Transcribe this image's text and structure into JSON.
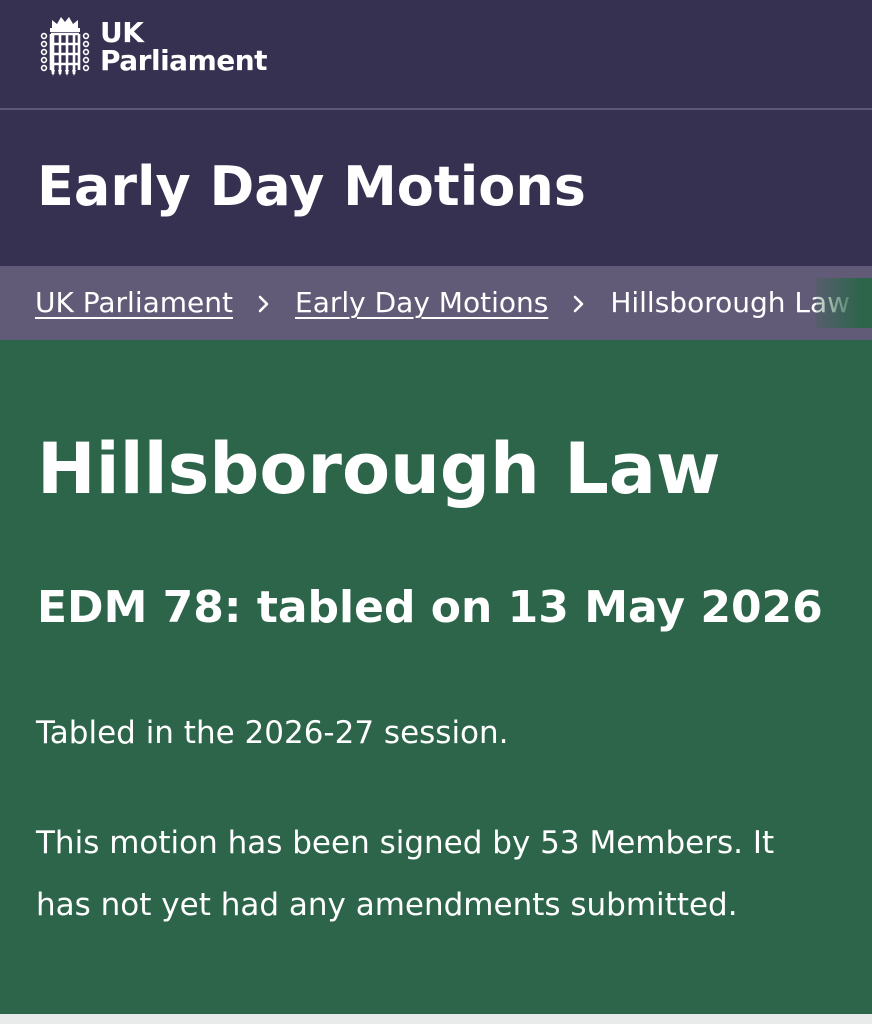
{
  "colors": {
    "brand_dark": "#373151",
    "breadcrumb_bg": "#625b78",
    "brand_green": "#2d654a"
  },
  "header": {
    "logo_icon": "portcullis-icon",
    "logo_line1": "UK",
    "logo_line2": "Parliament"
  },
  "section": {
    "title": "Early Day Motions"
  },
  "breadcrumb": {
    "items": [
      {
        "label": "UK Parliament"
      },
      {
        "label": "Early Day Motions"
      },
      {
        "label": "Hillsborough Law"
      }
    ],
    "separator_icon": "chevron-right-icon"
  },
  "motion": {
    "title": "Hillsborough Law",
    "subtitle": "EDM 78: tabled on 13 May 2026",
    "session_text": "Tabled in the 2026-27 session.",
    "summary_text": "This motion has been signed by 53 Members. It has not yet had any amendments submitted."
  }
}
